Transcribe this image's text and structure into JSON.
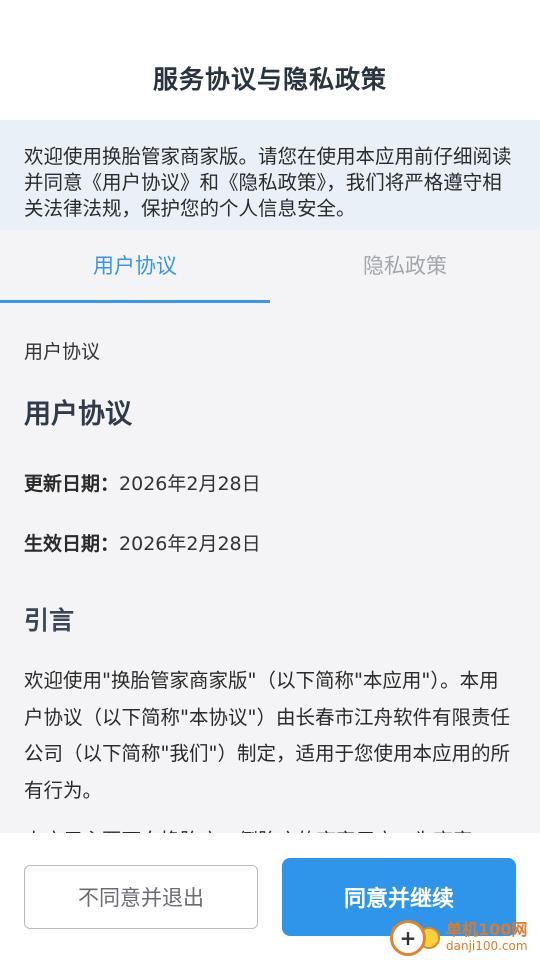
{
  "header": {
    "title": "服务协议与隐私政策"
  },
  "notice": {
    "text": "欢迎使用换胎管家商家版。请您在使用本应用前仔细阅读并同意《用户协议》和《隐私政策》，我们将严格遵守相关法律法规，保护您的个人信息安全。"
  },
  "tabs": [
    {
      "label": "用户协议",
      "active": true
    },
    {
      "label": "隐私政策",
      "active": false
    }
  ],
  "content": {
    "crumb": "用户协议",
    "heading": "用户协议",
    "update_label": "更新日期：",
    "update_value": "2026年2月28日",
    "effective_label": "生效日期：",
    "effective_value": "2026年2月28日",
    "section_title": "引言",
    "paragraph1": "欢迎使用\"换胎管家商家版\"（以下简称\"本应用\"）。本用户协议（以下简称\"本协议\"）由长春市江舟软件有限责任公司（以下简称\"我们\"）制定，适用于您使用本应用的所有行为。",
    "paragraph2": "本应用主要面向换胎店、倒胎店的商家用户，为商家"
  },
  "footer": {
    "decline_label": "不同意并退出",
    "accept_label": "同意并继续"
  },
  "watermark": {
    "name": "单机100网",
    "url": "danji100.com"
  },
  "colors": {
    "accent": "#2e95ea",
    "notice_bg": "#e9f0f7",
    "content_bg": "#f4f4f6"
  }
}
